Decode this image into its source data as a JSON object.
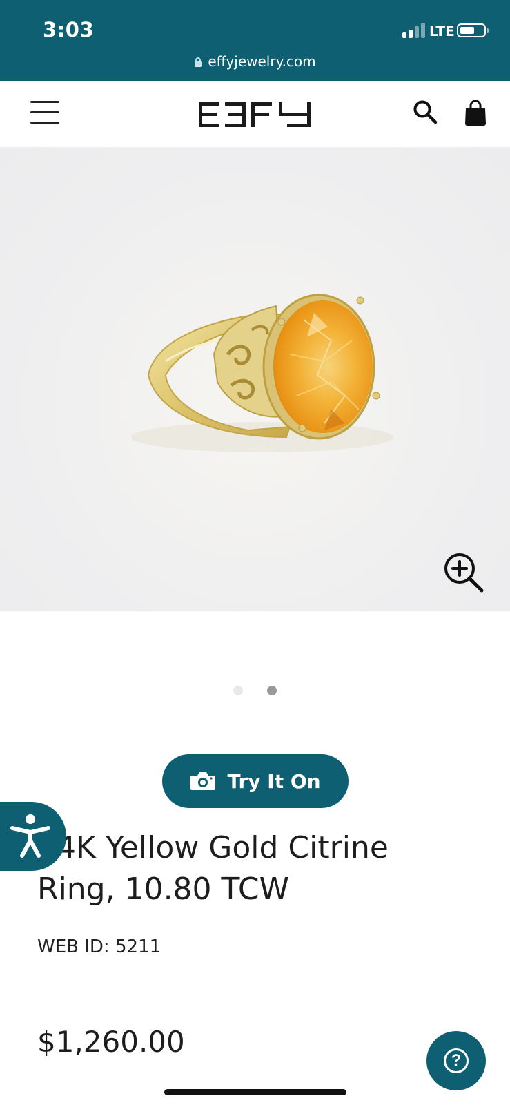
{
  "status_bar": {
    "time": "3:03",
    "network": "LTE",
    "url": "effyjewelry.com",
    "background_color": "#0f5f73"
  },
  "header": {
    "brand": "EFFY",
    "icons": [
      "menu-icon",
      "search-icon",
      "shopping-bag-icon"
    ]
  },
  "gallery": {
    "image_description_icon": "zoom-in-icon",
    "slides_total": 2,
    "active_slide": 2
  },
  "try_on": {
    "label": "Try It On",
    "icon": "camera-icon"
  },
  "product": {
    "title": "14K Yellow Gold Citrine Ring, 10.80 TCW",
    "web_id": "WEB ID: 5211",
    "price": "$1,260.00"
  },
  "floating": {
    "accessibility_icon": "accessibility-icon",
    "help_icon": "help-icon",
    "help_glyph": "?"
  },
  "colors": {
    "accent": "#0f5f73",
    "text": "#1d1d1d"
  }
}
